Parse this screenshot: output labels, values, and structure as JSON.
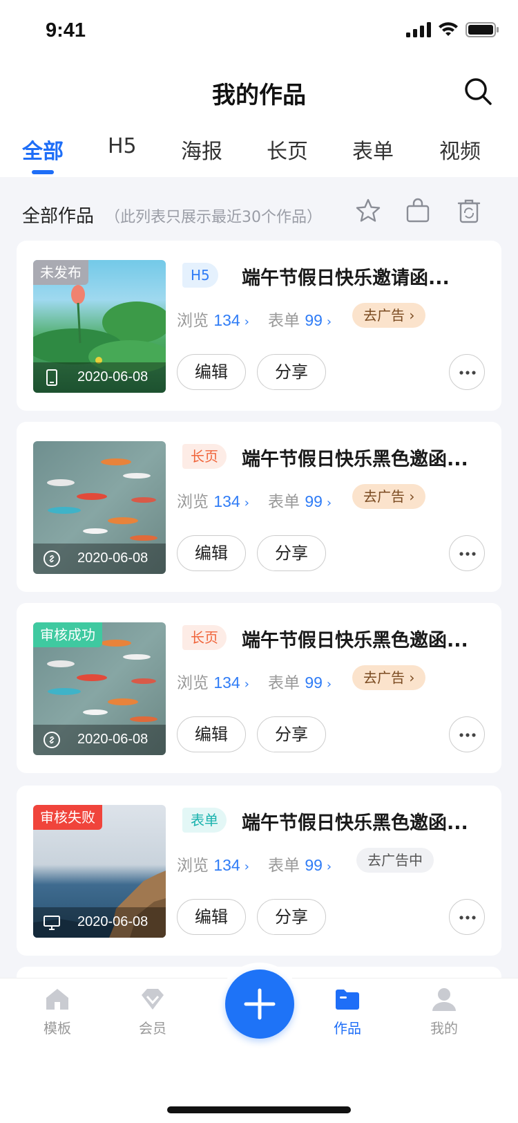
{
  "status_bar": {
    "time": "9:41"
  },
  "header": {
    "title": "我的作品"
  },
  "tabs": [
    {
      "label": "全部"
    },
    {
      "label": "H5"
    },
    {
      "label": "海报"
    },
    {
      "label": "长页"
    },
    {
      "label": "表单"
    },
    {
      "label": "视频"
    }
  ],
  "section": {
    "title": "全部作品",
    "note": "（此列表只展示最近30个作品）"
  },
  "works": [
    {
      "status": "未发布",
      "date": "2020-06-08",
      "type": "H5",
      "title": "端午节假日快乐邀请函...",
      "views_label": "浏览",
      "views": "134",
      "forms_label": "表单",
      "forms": "99",
      "ad": "去广告 ›",
      "edit": "编辑",
      "share": "分享"
    },
    {
      "status": "",
      "date": "2020-06-08",
      "type": "长页",
      "title": "端午节假日快乐黑色邀函...",
      "views_label": "浏览",
      "views": "134",
      "forms_label": "表单",
      "forms": "99",
      "ad": "去广告 ›",
      "edit": "编辑",
      "share": "分享"
    },
    {
      "status": "审核成功",
      "date": "2020-06-08",
      "type": "长页",
      "title": "端午节假日快乐黑色邀函...",
      "views_label": "浏览",
      "views": "134",
      "forms_label": "表单",
      "forms": "99",
      "ad": "去广告 ›",
      "edit": "编辑",
      "share": "分享"
    },
    {
      "status": "审核失败",
      "date": "2020-06-08",
      "type": "表单",
      "title": "端午节假日快乐黑色邀函...",
      "views_label": "浏览",
      "views": "134",
      "forms_label": "表单",
      "forms": "99",
      "ad": "去广告中",
      "edit": "编辑",
      "share": "分享"
    }
  ],
  "tabbar": [
    {
      "label": "模板",
      "icon": "home-icon"
    },
    {
      "label": "会员",
      "icon": "diamond-icon"
    },
    {
      "label": "",
      "icon": "plus-icon"
    },
    {
      "label": "作品",
      "icon": "folder-icon"
    },
    {
      "label": "我的",
      "icon": "user-icon"
    }
  ],
  "colors": {
    "accent": "#1e6ef7",
    "ad_bg": "#fbe3cc",
    "status_gray": "#a9aab2",
    "status_green": "#3fc9a0",
    "status_red": "#f0443b"
  }
}
